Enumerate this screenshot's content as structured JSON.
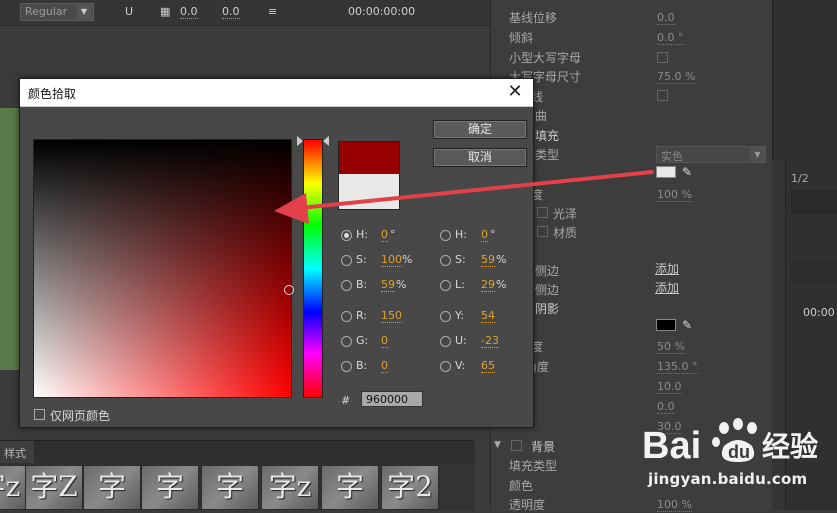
{
  "topbar": {
    "font_style": "Regular",
    "underline_glyph": "U",
    "val_a": "0.0",
    "val_b": "0.0",
    "timecode": "00:00:00:00"
  },
  "props": {
    "rows": [
      {
        "label": "基线位移",
        "value": "0.0"
      },
      {
        "label": "倾斜",
        "value": "0.0 °"
      },
      {
        "label": "小型大写字母",
        "value": ""
      },
      {
        "label": "大写字母尺寸",
        "value": "75.0 %"
      },
      {
        "label": "线",
        "value": ""
      },
      {
        "label": "曲",
        "value": ""
      },
      {
        "label": "填充",
        "value": ""
      },
      {
        "label": "类型",
        "value": ""
      },
      {
        "label": "度",
        "value": "100 %"
      },
      {
        "label": "光泽",
        "value": ""
      },
      {
        "label": "材质",
        "value": ""
      },
      {
        "label": "侧边",
        "value": ""
      },
      {
        "label": "侧边",
        "value": ""
      },
      {
        "label": "阴影",
        "value": ""
      },
      {
        "label": "度",
        "value": "50 %"
      },
      {
        "label": "角度",
        "value": "135.0 °"
      },
      {
        "label": "",
        "value": "10.0"
      },
      {
        "label": "",
        "value": "0.0"
      },
      {
        "label": "",
        "value": "30.0"
      },
      {
        "label": "背景",
        "value": ""
      },
      {
        "label": "填充类型",
        "value": ""
      },
      {
        "label": "颜色",
        "value": ""
      },
      {
        "label": "透明度",
        "value": "100 %"
      }
    ],
    "fill_type": "实色",
    "add_link_1": "添加",
    "add_link_2": "添加",
    "ratio_text": "1/2",
    "right_time": "00:00"
  },
  "thumbs": [
    "字z",
    "字Z",
    "字",
    "字",
    "字",
    "字z",
    "字",
    "字2"
  ],
  "bottom_tab": "样式",
  "dialog": {
    "title": "颜色拾取",
    "ok_label": "确定",
    "cancel_label": "取消",
    "web_only_label": "仅网页颜色",
    "hex_label": "#",
    "hex_value": "960000",
    "left_fields": [
      {
        "label": "H:",
        "value": "0",
        "unit": "°",
        "selected": true
      },
      {
        "label": "S:",
        "value": "100",
        "unit": "%",
        "selected": false
      },
      {
        "label": "B:",
        "value": "59",
        "unit": "%",
        "selected": false
      },
      {
        "label": "R:",
        "value": "150",
        "unit": "",
        "selected": false
      },
      {
        "label": "G:",
        "value": "0",
        "unit": "",
        "selected": false
      },
      {
        "label": "B:",
        "value": "0",
        "unit": "",
        "selected": false
      }
    ],
    "right_fields": [
      {
        "label": "H:",
        "value": "0",
        "unit": "°",
        "selected": false
      },
      {
        "label": "S:",
        "value": "59",
        "unit": "%",
        "selected": false
      },
      {
        "label": "L:",
        "value": "29",
        "unit": "%",
        "selected": false
      },
      {
        "label": "Y:",
        "value": "54",
        "unit": "",
        "selected": false
      },
      {
        "label": "U:",
        "value": "-23",
        "unit": "",
        "selected": false
      },
      {
        "label": "V:",
        "value": "65",
        "unit": "",
        "selected": false
      }
    ],
    "new_color": "#960000",
    "old_color": "#e8e8e8"
  },
  "watermark": {
    "logo_text": "Baidu经验",
    "url": "jingyan.baidu.com"
  },
  "colors": {
    "accent_orange": "#e0a030",
    "annotation_red": "#e2404a"
  },
  "icons": [
    "close-icon",
    "eyedropper-icon",
    "hue-slider-arrow-icon",
    "paw-icon"
  ]
}
